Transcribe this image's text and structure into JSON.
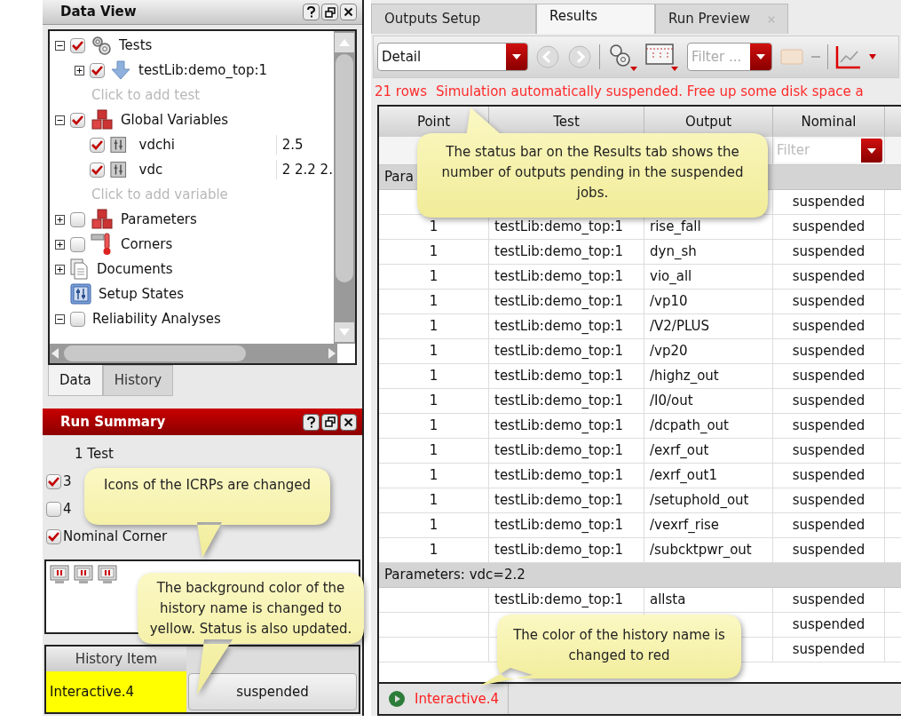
{
  "data_view": {
    "title": "Data View",
    "tree": [
      {
        "kind": "tests",
        "label": "Tests",
        "expanded": true,
        "checked": true,
        "children": [
          {
            "kind": "test",
            "label": "testLib:demo_top:1",
            "expanded": false,
            "checked": true
          },
          {
            "kind": "hint",
            "label": "Click to add test"
          }
        ]
      },
      {
        "kind": "variables",
        "label": "Global Variables",
        "expanded": true,
        "checked": true,
        "children": [
          {
            "kind": "variable",
            "label": "vdchi",
            "value": "2.5",
            "checked": true
          },
          {
            "kind": "variable",
            "label": "vdc",
            "value": "2 2.2 2.",
            "checked": true
          },
          {
            "kind": "hint",
            "label": "Click to add variable"
          }
        ]
      },
      {
        "kind": "parameters",
        "label": "Parameters",
        "expanded": false,
        "checked": false
      },
      {
        "kind": "corners",
        "label": "Corners",
        "expanded": false,
        "checked": false
      },
      {
        "kind": "documents",
        "label": "Documents",
        "expanded": false
      },
      {
        "kind": "setup_states",
        "label": "Setup States"
      },
      {
        "kind": "reliability",
        "label": "Reliability Analyses",
        "expanded": true,
        "checked": false
      }
    ],
    "tabs": [
      {
        "label": "Data",
        "selected": true
      },
      {
        "label": "History",
        "selected": false
      }
    ]
  },
  "run_summary": {
    "title": "Run Summary",
    "items": [
      {
        "label": "1 Test"
      },
      {
        "label": "3",
        "checked": true
      },
      {
        "label": "4",
        "checked": false
      },
      {
        "label": "Nominal Corner",
        "checked": true
      }
    ],
    "icrps": [
      {
        "kind": "paused"
      },
      {
        "kind": "paused"
      },
      {
        "kind": "paused"
      }
    ],
    "history": {
      "column": "History Item",
      "rows": [
        {
          "name": "Interactive.4",
          "status": "suspended",
          "highlighted": true
        }
      ]
    }
  },
  "results": {
    "tabs": [
      {
        "label": "Outputs Setup",
        "selected": false
      },
      {
        "label": "Results",
        "selected": true
      },
      {
        "label": "Run Preview",
        "selected": false,
        "closable": true
      }
    ],
    "toolbar": {
      "view": "Detail",
      "filter_placeholder": "Filter ..."
    },
    "status": {
      "count": "21 rows",
      "message": "Simulation automatically suspended. Free up some disk space a"
    },
    "table": {
      "columns": [
        "Point",
        "Test",
        "Output",
        "Nominal"
      ],
      "nominal_filter": "Filter",
      "rows": [
        {
          "kind": "group",
          "label": "Para"
        },
        {
          "kind": "result",
          "point": "",
          "test": "",
          "output": "",
          "nominal": "suspended"
        },
        {
          "kind": "result",
          "point": "1",
          "test": "testLib:demo_top:1",
          "output": "rise_fall",
          "nominal": "suspended"
        },
        {
          "kind": "result",
          "point": "1",
          "test": "testLib:demo_top:1",
          "output": "dyn_sh",
          "nominal": "suspended"
        },
        {
          "kind": "result",
          "point": "1",
          "test": "testLib:demo_top:1",
          "output": "vio_all",
          "nominal": "suspended"
        },
        {
          "kind": "result",
          "point": "1",
          "test": "testLib:demo_top:1",
          "output": "/vp10",
          "nominal": "suspended"
        },
        {
          "kind": "result",
          "point": "1",
          "test": "testLib:demo_top:1",
          "output": "/V2/PLUS",
          "nominal": "suspended"
        },
        {
          "kind": "result",
          "point": "1",
          "test": "testLib:demo_top:1",
          "output": "/vp20",
          "nominal": "suspended"
        },
        {
          "kind": "result",
          "point": "1",
          "test": "testLib:demo_top:1",
          "output": "/highz_out",
          "nominal": "suspended"
        },
        {
          "kind": "result",
          "point": "1",
          "test": "testLib:demo_top:1",
          "output": "/I0/out",
          "nominal": "suspended"
        },
        {
          "kind": "result",
          "point": "1",
          "test": "testLib:demo_top:1",
          "output": "/dcpath_out",
          "nominal": "suspended"
        },
        {
          "kind": "result",
          "point": "1",
          "test": "testLib:demo_top:1",
          "output": "/exrf_out",
          "nominal": "suspended"
        },
        {
          "kind": "result",
          "point": "1",
          "test": "testLib:demo_top:1",
          "output": "/exrf_out1",
          "nominal": "suspended"
        },
        {
          "kind": "result",
          "point": "1",
          "test": "testLib:demo_top:1",
          "output": "/setuphold_out",
          "nominal": "suspended"
        },
        {
          "kind": "result",
          "point": "1",
          "test": "testLib:demo_top:1",
          "output": "/vexrf_rise",
          "nominal": "suspended"
        },
        {
          "kind": "result",
          "point": "1",
          "test": "testLib:demo_top:1",
          "output": "/subcktpwr_out",
          "nominal": "suspended"
        },
        {
          "kind": "group",
          "label": "Parameters: vdc=2.2"
        },
        {
          "kind": "result",
          "point": "",
          "test": "testLib:demo_top:1",
          "output": "allsta",
          "nominal": "suspended"
        },
        {
          "kind": "result",
          "point": "",
          "test": "",
          "output": "",
          "nominal": "suspended"
        },
        {
          "kind": "result",
          "point": "",
          "test": "",
          "output": "",
          "nominal": "suspended"
        }
      ]
    },
    "history_tab": {
      "label": "Interactive.4"
    }
  },
  "callouts": [
    {
      "text": "The status bar on the Results tab shows the number of outputs pending in the suspended jobs."
    },
    {
      "text": "Icons of the ICRPs are changed"
    },
    {
      "text": "The background color of the history name is changed to yellow. Status is also updated."
    },
    {
      "text": "The color of the history name is changed to red"
    }
  ]
}
